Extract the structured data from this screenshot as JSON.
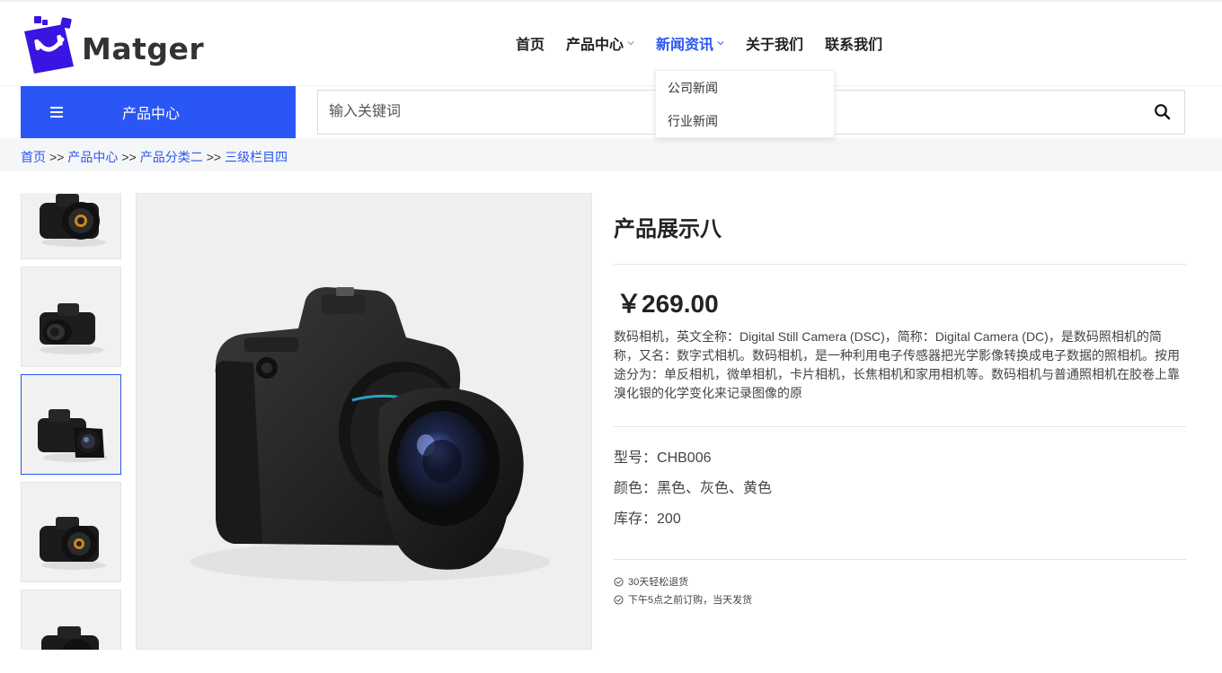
{
  "brand": {
    "name": "Matger"
  },
  "nav": {
    "items": [
      {
        "label": "首页",
        "has_caret": false,
        "active": false
      },
      {
        "label": "产品中心",
        "has_caret": true,
        "active": false
      },
      {
        "label": "新闻资讯",
        "has_caret": true,
        "active": true
      },
      {
        "label": "关于我们",
        "has_caret": false,
        "active": false
      },
      {
        "label": "联系我们",
        "has_caret": false,
        "active": false
      }
    ],
    "dropdown": [
      "公司新闻",
      "行业新闻"
    ]
  },
  "category_bar": {
    "label": "产品中心"
  },
  "search": {
    "placeholder": "输入关键词",
    "value": ""
  },
  "breadcrumb": {
    "items": [
      "首页",
      "产品中心",
      "产品分类二",
      "三级栏目四"
    ],
    "separator": ">>"
  },
  "product": {
    "title": "产品展示八",
    "price": "￥269.00",
    "description": "数码相机，英文全称：Digital Still Camera (DSC)，简称：Digital Camera (DC)，是数码照相机的简称，又名：数字式相机。数码相机，是一种利用电子传感器把光学影像转换成电子数据的照相机。按用途分为：单反相机，微单相机，卡片相机，长焦相机和家用相机等。数码相机与普通照相机在胶卷上靠溴化银的化学变化来记录图像的原",
    "specs": [
      {
        "label": "型号：",
        "value": "CHB006"
      },
      {
        "label": "颜色：",
        "value": "黑色、灰色、黄色"
      },
      {
        "label": "库存：",
        "value": "200"
      }
    ],
    "perks": [
      "30天轻松退货",
      "下午5点之前订购，当天发货"
    ],
    "thumbnail_count": 5,
    "active_thumbnail": 3
  },
  "colors": {
    "accent": "#2a56f5",
    "logo": "#3a14e0",
    "text": "#333333",
    "crumb_bg": "#f5f6f8"
  },
  "icons": {
    "search": "search-icon",
    "menu": "menu-icon",
    "caret": "chevron-down-icon",
    "perk": "check-circle-icon"
  }
}
